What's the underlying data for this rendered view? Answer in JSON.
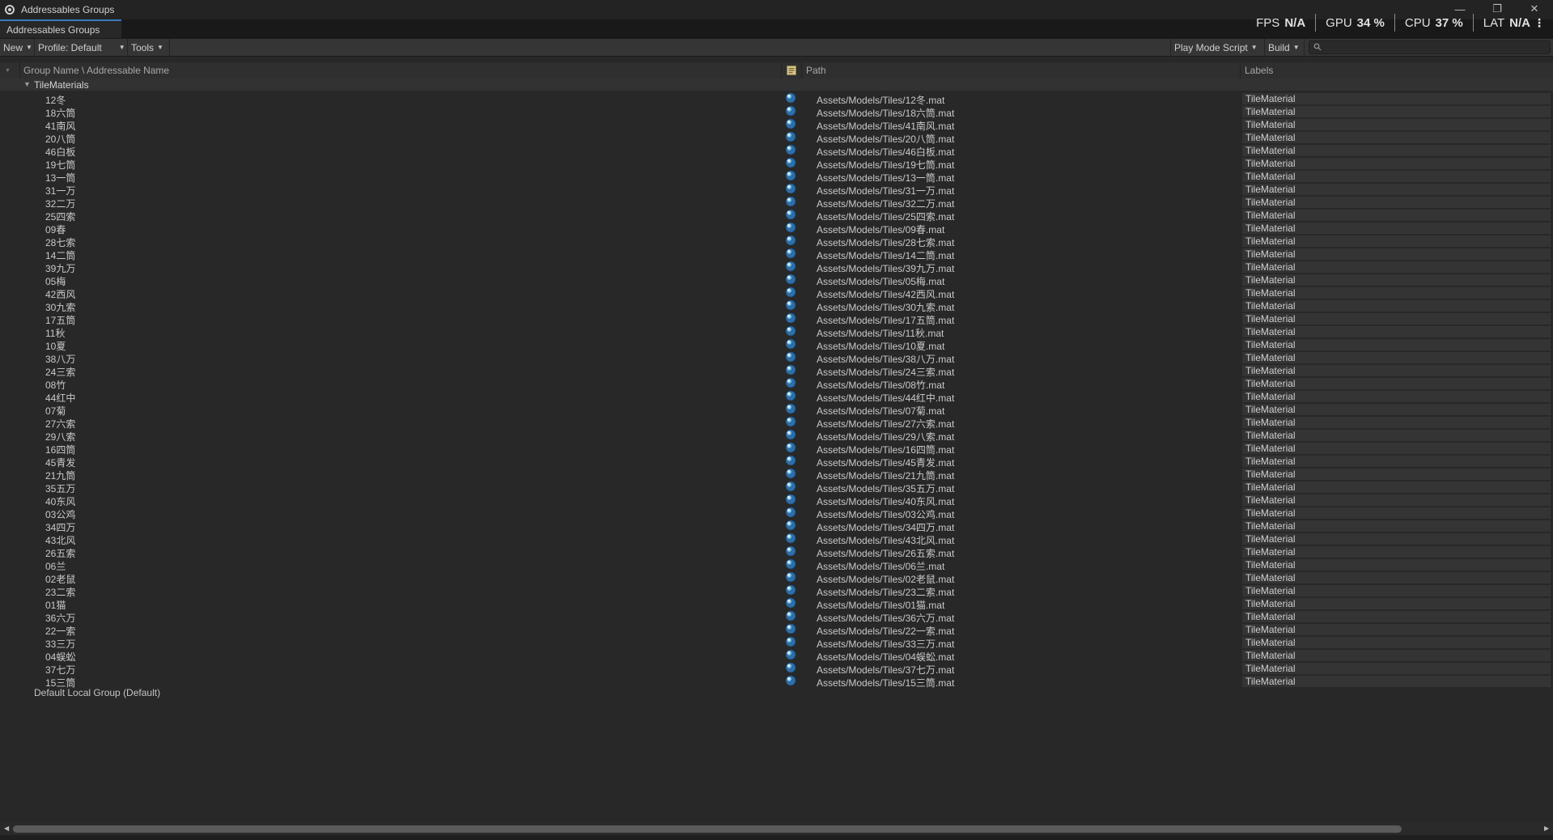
{
  "window": {
    "title": "Addressables Groups",
    "controls": [
      "—",
      "❐",
      "✕"
    ]
  },
  "tab": {
    "label": "Addressables Groups"
  },
  "perf": {
    "fps_label": "FPS",
    "fps_value": "N/A",
    "gpu_label": "GPU",
    "gpu_value": "34 %",
    "cpu_label": "CPU",
    "cpu_value": "37 %",
    "lat_label": "LAT",
    "lat_value": "N/A",
    "menu": "⋮"
  },
  "toolbar": {
    "new_label": "New",
    "profile_label": "Profile: Default",
    "tools_label": "Tools",
    "play_mode_label": "Play Mode Script",
    "build_label": "Build",
    "search_placeholder": ""
  },
  "columns": {
    "name": "Group Name \\ Addressable Name",
    "path": "Path",
    "labels": "Labels"
  },
  "group": {
    "name": "TileMaterials",
    "expanded": true,
    "entries": [
      {
        "name": "12冬",
        "path": "Assets/Models/Tiles/12冬.mat",
        "label": "TileMaterial"
      },
      {
        "name": "18六筒",
        "path": "Assets/Models/Tiles/18六筒.mat",
        "label": "TileMaterial"
      },
      {
        "name": "41南风",
        "path": "Assets/Models/Tiles/41南风.mat",
        "label": "TileMaterial"
      },
      {
        "name": "20八筒",
        "path": "Assets/Models/Tiles/20八筒.mat",
        "label": "TileMaterial"
      },
      {
        "name": "46白板",
        "path": "Assets/Models/Tiles/46白板.mat",
        "label": "TileMaterial"
      },
      {
        "name": "19七筒",
        "path": "Assets/Models/Tiles/19七筒.mat",
        "label": "TileMaterial"
      },
      {
        "name": "13一筒",
        "path": "Assets/Models/Tiles/13一筒.mat",
        "label": "TileMaterial"
      },
      {
        "name": "31一万",
        "path": "Assets/Models/Tiles/31一万.mat",
        "label": "TileMaterial"
      },
      {
        "name": "32二万",
        "path": "Assets/Models/Tiles/32二万.mat",
        "label": "TileMaterial"
      },
      {
        "name": "25四索",
        "path": "Assets/Models/Tiles/25四索.mat",
        "label": "TileMaterial"
      },
      {
        "name": "09春",
        "path": "Assets/Models/Tiles/09春.mat",
        "label": "TileMaterial"
      },
      {
        "name": "28七索",
        "path": "Assets/Models/Tiles/28七索.mat",
        "label": "TileMaterial"
      },
      {
        "name": "14二筒",
        "path": "Assets/Models/Tiles/14二筒.mat",
        "label": "TileMaterial"
      },
      {
        "name": "39九万",
        "path": "Assets/Models/Tiles/39九万.mat",
        "label": "TileMaterial"
      },
      {
        "name": "05梅",
        "path": "Assets/Models/Tiles/05梅.mat",
        "label": "TileMaterial"
      },
      {
        "name": "42西风",
        "path": "Assets/Models/Tiles/42西风.mat",
        "label": "TileMaterial"
      },
      {
        "name": "30九索",
        "path": "Assets/Models/Tiles/30九索.mat",
        "label": "TileMaterial"
      },
      {
        "name": "17五筒",
        "path": "Assets/Models/Tiles/17五筒.mat",
        "label": "TileMaterial"
      },
      {
        "name": "11秋",
        "path": "Assets/Models/Tiles/11秋.mat",
        "label": "TileMaterial"
      },
      {
        "name": "10夏",
        "path": "Assets/Models/Tiles/10夏.mat",
        "label": "TileMaterial"
      },
      {
        "name": "38八万",
        "path": "Assets/Models/Tiles/38八万.mat",
        "label": "TileMaterial"
      },
      {
        "name": "24三索",
        "path": "Assets/Models/Tiles/24三索.mat",
        "label": "TileMaterial"
      },
      {
        "name": "08竹",
        "path": "Assets/Models/Tiles/08竹.mat",
        "label": "TileMaterial"
      },
      {
        "name": "44红中",
        "path": "Assets/Models/Tiles/44红中.mat",
        "label": "TileMaterial"
      },
      {
        "name": "07菊",
        "path": "Assets/Models/Tiles/07菊.mat",
        "label": "TileMaterial"
      },
      {
        "name": "27六索",
        "path": "Assets/Models/Tiles/27六索.mat",
        "label": "TileMaterial"
      },
      {
        "name": "29八索",
        "path": "Assets/Models/Tiles/29八索.mat",
        "label": "TileMaterial"
      },
      {
        "name": "16四筒",
        "path": "Assets/Models/Tiles/16四筒.mat",
        "label": "TileMaterial"
      },
      {
        "name": "45青发",
        "path": "Assets/Models/Tiles/45青发.mat",
        "label": "TileMaterial"
      },
      {
        "name": "21九筒",
        "path": "Assets/Models/Tiles/21九筒.mat",
        "label": "TileMaterial"
      },
      {
        "name": "35五万",
        "path": "Assets/Models/Tiles/35五万.mat",
        "label": "TileMaterial"
      },
      {
        "name": "40东风",
        "path": "Assets/Models/Tiles/40东风.mat",
        "label": "TileMaterial"
      },
      {
        "name": "03公鸡",
        "path": "Assets/Models/Tiles/03公鸡.mat",
        "label": "TileMaterial"
      },
      {
        "name": "34四万",
        "path": "Assets/Models/Tiles/34四万.mat",
        "label": "TileMaterial"
      },
      {
        "name": "43北风",
        "path": "Assets/Models/Tiles/43北风.mat",
        "label": "TileMaterial"
      },
      {
        "name": "26五索",
        "path": "Assets/Models/Tiles/26五索.mat",
        "label": "TileMaterial"
      },
      {
        "name": "06兰",
        "path": "Assets/Models/Tiles/06兰.mat",
        "label": "TileMaterial"
      },
      {
        "name": "02老鼠",
        "path": "Assets/Models/Tiles/02老鼠.mat",
        "label": "TileMaterial"
      },
      {
        "name": "23二索",
        "path": "Assets/Models/Tiles/23二索.mat",
        "label": "TileMaterial"
      },
      {
        "name": "01猫",
        "path": "Assets/Models/Tiles/01猫.mat",
        "label": "TileMaterial"
      },
      {
        "name": "36六万",
        "path": "Assets/Models/Tiles/36六万.mat",
        "label": "TileMaterial"
      },
      {
        "name": "22一索",
        "path": "Assets/Models/Tiles/22一索.mat",
        "label": "TileMaterial"
      },
      {
        "name": "33三万",
        "path": "Assets/Models/Tiles/33三万.mat",
        "label": "TileMaterial"
      },
      {
        "name": "04蜈蚣",
        "path": "Assets/Models/Tiles/04蜈蚣.mat",
        "label": "TileMaterial"
      },
      {
        "name": "37七万",
        "path": "Assets/Models/Tiles/37七万.mat",
        "label": "TileMaterial"
      },
      {
        "name": "15三筒",
        "path": "Assets/Models/Tiles/15三筒.mat",
        "label": "TileMaterial"
      }
    ]
  },
  "default_group": {
    "name": "Default Local Group (Default)"
  },
  "colors": {
    "accent": "#3a79bb",
    "background": "#282828",
    "row_label_bg": "#343434"
  },
  "icons": {
    "app": "addressables-gear-icon",
    "entry": "material-sphere-icon",
    "path_header": "asset-type-icon",
    "search": "search-icon"
  }
}
